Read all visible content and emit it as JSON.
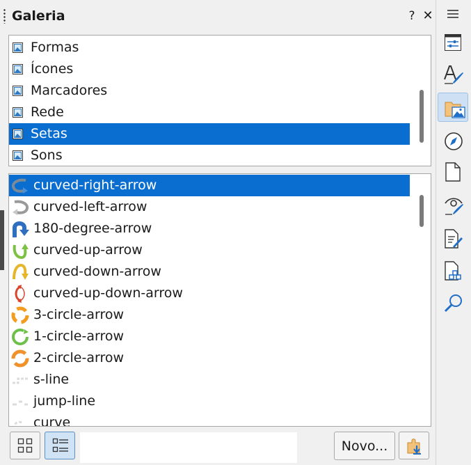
{
  "panel": {
    "title": "Galeria",
    "help_label": "?",
    "close_label": "✕",
    "menu_label": "☰"
  },
  "themes": {
    "items": [
      {
        "label": "Formas",
        "selected": false
      },
      {
        "label": "Ícones",
        "selected": false
      },
      {
        "label": "Marcadores",
        "selected": false
      },
      {
        "label": "Rede",
        "selected": false
      },
      {
        "label": "Setas",
        "selected": true
      },
      {
        "label": "Sons",
        "selected": false
      }
    ]
  },
  "gallery_items": {
    "items": [
      {
        "label": "curved-right-arrow",
        "icon": "curved-right-arrow-icon",
        "selected": true
      },
      {
        "label": "curved-left-arrow",
        "icon": "curved-left-arrow-icon",
        "selected": false
      },
      {
        "label": "180-degree-arrow",
        "icon": "u-turn-arrow-icon",
        "selected": false
      },
      {
        "label": "curved-up-arrow",
        "icon": "curved-up-arrow-icon",
        "selected": false
      },
      {
        "label": "curved-down-arrow",
        "icon": "curved-down-arrow-icon",
        "selected": false
      },
      {
        "label": "curved-up-down-arrow",
        "icon": "curved-up-down-arrow-icon",
        "selected": false
      },
      {
        "label": "3-circle-arrow",
        "icon": "3-circle-arrow-icon",
        "selected": false
      },
      {
        "label": "1-circle-arrow",
        "icon": "1-circle-arrow-icon",
        "selected": false
      },
      {
        "label": "2-circle-arrow",
        "icon": "2-circle-arrow-icon",
        "selected": false
      },
      {
        "label": "s-line",
        "icon": "s-line-icon",
        "selected": false
      },
      {
        "label": "jump-line",
        "icon": "jump-line-icon",
        "selected": false
      },
      {
        "label": "curve",
        "icon": "curve-icon",
        "selected": false
      }
    ]
  },
  "toolbar": {
    "search_value": "",
    "search_placeholder": "",
    "new_button_label": "Novo..."
  },
  "sidebar_deck": [
    {
      "name": "properties-deck-icon",
      "active": false
    },
    {
      "name": "styles-deck-icon",
      "active": false
    },
    {
      "name": "gallery-deck-icon",
      "active": true
    },
    {
      "name": "navigator-deck-icon",
      "active": false
    },
    {
      "name": "page-deck-icon",
      "active": false
    },
    {
      "name": "style-inspector-deck-icon",
      "active": false
    },
    {
      "name": "manage-changes-deck-icon",
      "active": false
    },
    {
      "name": "design-deck-icon",
      "active": false
    },
    {
      "name": "find-replace-deck-icon",
      "active": false
    }
  ],
  "colors": {
    "selection": "#0a6ed1",
    "toolbar_active": "#cfe3f5",
    "deck_active": "#cde0f4"
  }
}
